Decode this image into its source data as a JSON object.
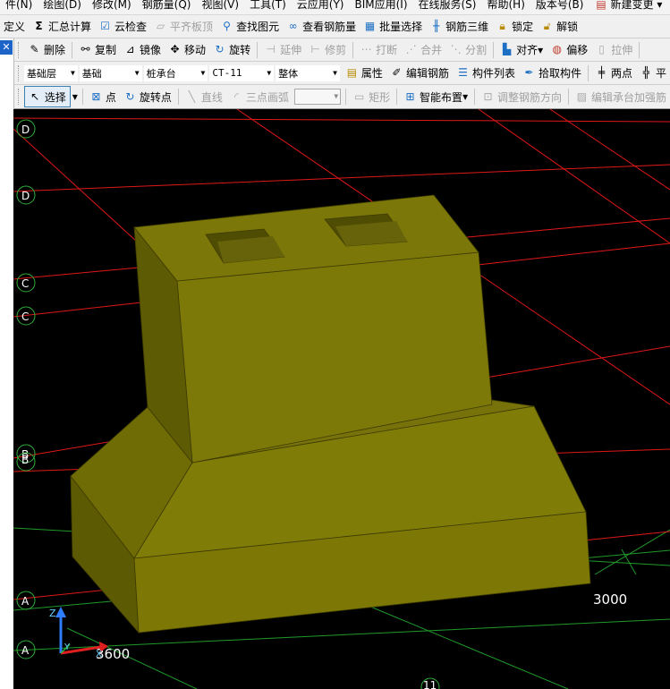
{
  "menu": [
    "件(N)",
    "绘图(D)",
    "修改(M)",
    "钢筋量(Q)",
    "视图(V)",
    "工具(T)",
    "云应用(Y)",
    "BIM应用(I)",
    "在线服务(S)",
    "帮助(H)",
    "版本号(B)",
    "新建变更"
  ],
  "toolbar1": {
    "define": "定义",
    "summary_calc": "汇总计算",
    "cloud_check": "云检查",
    "flush_slab": "平齐板顶",
    "find_element": "查找图元",
    "view_rebar_qty": "查看钢筋量",
    "batch_select": "批量选择",
    "rebar_3d": "钢筋三维",
    "lock": "锁定",
    "unlock": "解锁"
  },
  "toolbar2": {
    "delete": "删除",
    "copy": "复制",
    "mirror": "镜像",
    "move": "移动",
    "rotate": "旋转",
    "extend": "延伸",
    "trim": "修剪",
    "break": "打断",
    "merge": "合并",
    "split": "分割",
    "align": "对齐",
    "offset": "偏移",
    "stretch": "拉伸"
  },
  "toolbar3": {
    "floor": "基础层",
    "category": "基础",
    "component_type": "桩承台",
    "component_name": "CT-11",
    "scope": "整体",
    "properties": "属性",
    "edit_rebar": "编辑钢筋",
    "component_list": "构件列表",
    "pick_component": "拾取构件",
    "two_points": "两点",
    "parallel": "平"
  },
  "toolbar4": {
    "select": "选择",
    "point": "点",
    "rotate_point": "旋转点",
    "line": "直线",
    "three_point_arc": "三点画弧",
    "rectangle": "矩形",
    "smart_layout": "智能布置",
    "adjust_rebar_dir": "调整钢筋方向",
    "edit_cap_rebar": "编辑承台加强筋"
  },
  "viewport": {
    "axis_labels": [
      "D",
      "D",
      "C",
      "C",
      "B",
      "B",
      "A",
      "A"
    ],
    "column_label": "11",
    "dim_right": "3000",
    "dim_bottom": "3600",
    "coord_axes": [
      "Z",
      "Y",
      "X"
    ],
    "colors": {
      "background": "#000000",
      "cap_top": "#7b7708",
      "cap_front": "#7f7a06",
      "cap_side": "#5d5a04",
      "grid_red": "#e01818",
      "grid_green": "#1f9a2a",
      "axis_bubble": "#2fae3a"
    }
  }
}
